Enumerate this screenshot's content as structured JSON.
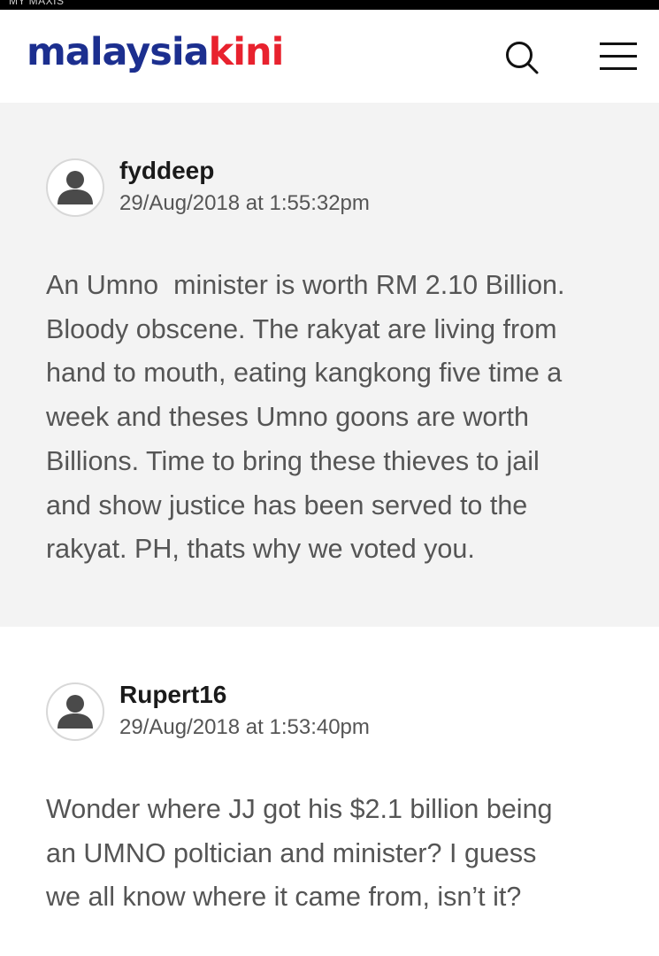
{
  "status_bar": {
    "carrier": "MY MAXIS"
  },
  "header": {
    "logo_part1": "malaysia",
    "logo_part2": "kini",
    "search_icon": "search-icon",
    "menu_icon": "hamburger-menu-icon"
  },
  "colors": {
    "logo_blue": "#1c2f8f",
    "logo_red": "#e8222e",
    "comment_bg_highlight": "#f3f3f3",
    "text_gray": "#555555"
  },
  "comments": [
    {
      "username": "fyddeep",
      "timestamp": "29/Aug/2018 at 1:55:32pm",
      "avatar_icon": "user-avatar-icon",
      "lines": [
        "An Umno  minister is worth RM 2.10 Billion.",
        "Bloody obscene. The rakyat are living from",
        "hand to mouth, eating kangkong five time a",
        "week and theses Umno goons are worth",
        "Billions. Time to bring these thieves to jail",
        "and show justice has been served to the",
        "rakyat. PH, thats why we voted you."
      ]
    },
    {
      "username": "Rupert16",
      "timestamp": "29/Aug/2018 at 1:53:40pm",
      "avatar_icon": "user-avatar-icon",
      "lines": [
        "Wonder where JJ got his $2.1 billion being",
        "an UMNO poltician and minister? I guess",
        "we all know where it came from, isn’t it?"
      ]
    }
  ]
}
